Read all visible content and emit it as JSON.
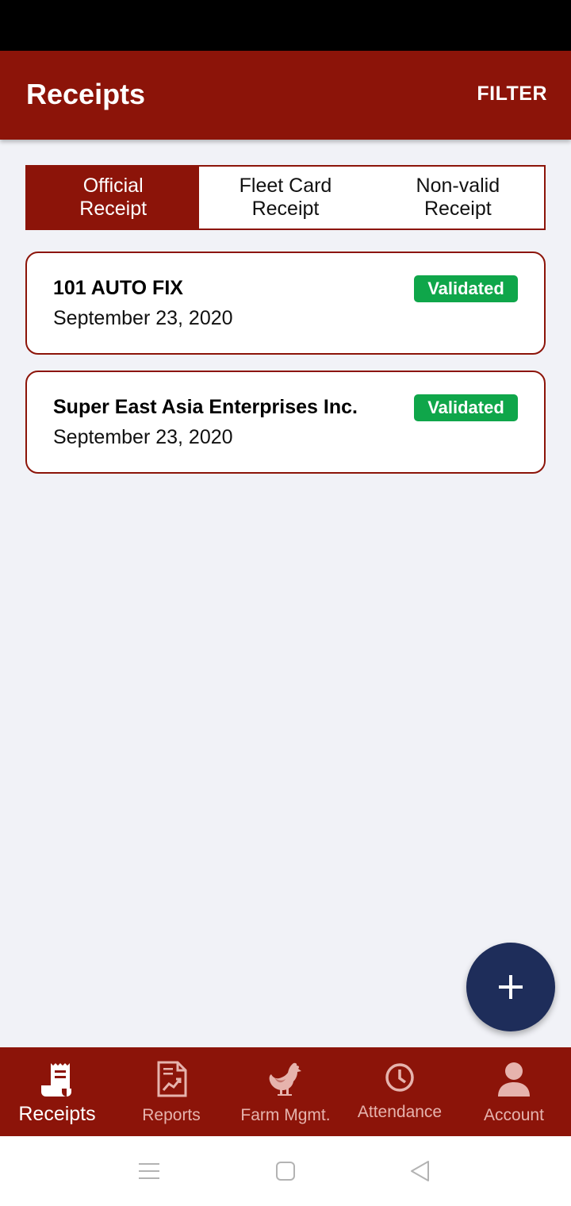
{
  "app_bar": {
    "title": "Receipts",
    "filter_label": "FILTER"
  },
  "tabs": [
    {
      "label": "Official\nReceipt",
      "active": true
    },
    {
      "label": "Fleet Card\nReceipt",
      "active": false
    },
    {
      "label": "Non-valid\nReceipt",
      "active": false
    }
  ],
  "receipts": [
    {
      "name": "101 AUTO FIX",
      "date": "September 23, 2020",
      "status": "Validated"
    },
    {
      "name": "Super East Asia Enterprises Inc.",
      "date": "September 23, 2020",
      "status": "Validated"
    }
  ],
  "fab": {
    "icon": "plus-icon"
  },
  "bottom_nav": [
    {
      "label": "Receipts",
      "icon": "receipt-icon",
      "active": true
    },
    {
      "label": "Reports",
      "icon": "report-chart-icon",
      "active": false
    },
    {
      "label": "Farm Mgmt.",
      "icon": "chicken-icon",
      "active": false
    },
    {
      "label": "Attendance",
      "icon": "clock-icon",
      "active": false
    },
    {
      "label": "Account",
      "icon": "person-icon",
      "active": false
    }
  ],
  "colors": {
    "primary": "#8c1409",
    "badge_green": "#0fa64a",
    "fab": "#1e2d5a"
  }
}
